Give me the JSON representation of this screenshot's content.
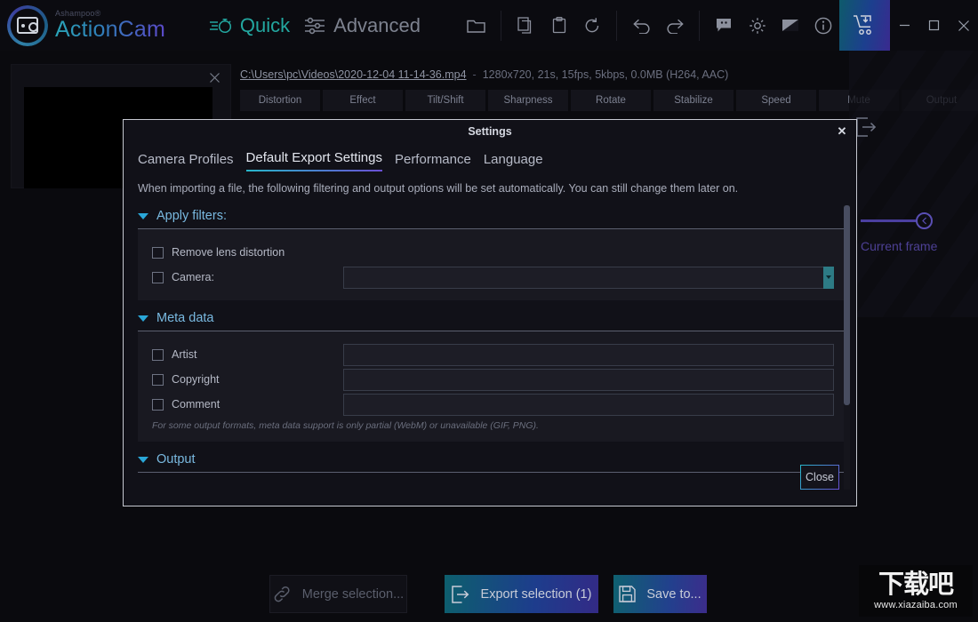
{
  "app": {
    "vendor": "Ashampoo®",
    "name": "ActionCam",
    "logo_icon": "camera-circle-logo"
  },
  "titlebar": {
    "modes": [
      {
        "label": "Quick",
        "icon": "stopwatch-icon",
        "active": true
      },
      {
        "label": "Advanced",
        "icon": "sliders-icon",
        "active": false
      }
    ],
    "tools": [
      {
        "name": "open-folder",
        "icon": "folder-icon"
      },
      {
        "name": "copy",
        "icon": "copy-icon"
      },
      {
        "name": "paste",
        "icon": "clipboard-icon"
      },
      {
        "name": "reset",
        "icon": "refresh-icon"
      },
      {
        "name": "undo",
        "icon": "undo-arrow-icon"
      },
      {
        "name": "redo",
        "icon": "redo-arrow-icon"
      },
      {
        "name": "feedback",
        "icon": "chat-icon"
      },
      {
        "name": "settings",
        "icon": "gear-icon"
      },
      {
        "name": "theme",
        "icon": "image-icon"
      },
      {
        "name": "info",
        "icon": "info-circle-icon"
      }
    ],
    "cart_icon": "shopping-cart-download-icon",
    "window_controls": [
      {
        "name": "minimize",
        "glyph": "–"
      },
      {
        "name": "maximize",
        "glyph": "□"
      },
      {
        "name": "close",
        "glyph": "✕"
      }
    ]
  },
  "workspace": {
    "card": {
      "close_icon": "close-icon",
      "thumbnail": "video-thumbnail-black"
    },
    "file": {
      "path": "C:\\Users\\pc\\Videos\\2020-12-04 11-14-36.mp4",
      "separator": "-",
      "info": "1280x720, 21s, 15fps, 5kbps, 0.0MB (H264, AAC)"
    },
    "video_tabs": [
      "Distortion",
      "Effect",
      "Tilt/Shift",
      "Sharpness",
      "Rotate",
      "Stabilize",
      "Speed",
      "Mute",
      "Output"
    ],
    "right_panel": {
      "export_icon": "export-arrow-icon",
      "slider_label": "Current frame",
      "slider_knob_icon": "chevron-left-icon"
    }
  },
  "footer": {
    "buttons": [
      {
        "label": "Merge selection...",
        "icon": "link-icon",
        "style": "ghost"
      },
      {
        "label": "Export selection (1)",
        "icon": "export-arrow-icon",
        "style": "gradient"
      },
      {
        "label": "Save to...",
        "icon": "floppy-disk-icon",
        "style": "gradient"
      }
    ],
    "watermark": {
      "cn": "下载吧",
      "url": "www.xiazaiba.com"
    }
  },
  "dialog": {
    "title": "Settings",
    "close_icon": "close-icon",
    "tabs": [
      {
        "label": "Camera Profiles",
        "active": false
      },
      {
        "label": "Default Export Settings",
        "active": true
      },
      {
        "label": "Performance",
        "active": false
      },
      {
        "label": "Language",
        "active": false
      }
    ],
    "intro": "When importing a file, the following filtering and output options will be set automatically. You can still change them later on.",
    "sections": {
      "filters": {
        "title": "Apply filters:",
        "caret_icon": "caret-down-icon",
        "rows": [
          {
            "label": "Remove lens distortion",
            "checked": false,
            "control": "none"
          },
          {
            "label": "Camera:",
            "checked": false,
            "control": "combo",
            "value": ""
          }
        ]
      },
      "metadata": {
        "title": "Meta data",
        "caret_icon": "caret-down-icon",
        "rows": [
          {
            "label": "Artist",
            "checked": false,
            "value": ""
          },
          {
            "label": "Copyright",
            "checked": false,
            "value": ""
          },
          {
            "label": "Comment",
            "checked": false,
            "value": ""
          }
        ],
        "note": "For some output formats, meta data support is only partial (WebM) or unavailable (GIF, PNG)."
      },
      "output": {
        "title": "Output",
        "caret_icon": "caret-down-icon"
      }
    },
    "close_button": "Close"
  }
}
